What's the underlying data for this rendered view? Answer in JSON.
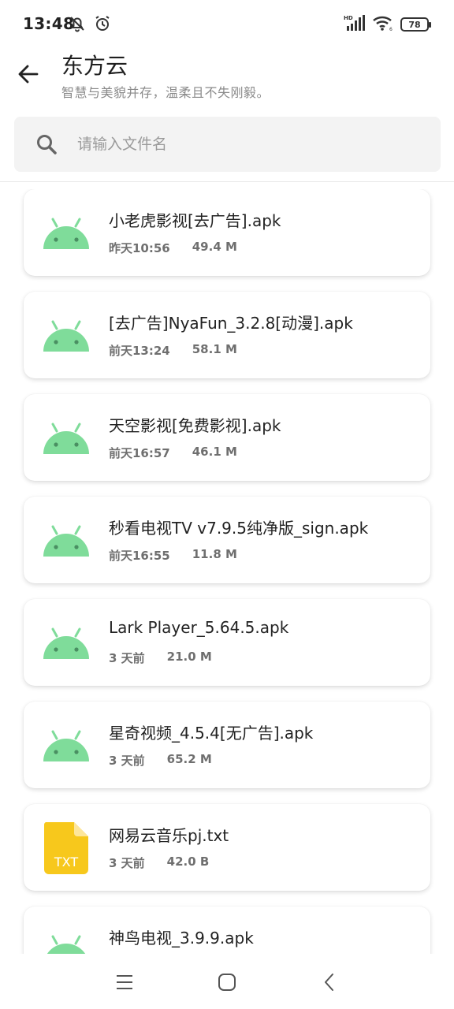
{
  "status_bar": {
    "time": "13:48",
    "battery": "78",
    "icons": [
      "bell-off-icon",
      "alarm-icon",
      "hd-signal-icon",
      "wifi-icon",
      "battery-icon"
    ]
  },
  "header": {
    "title": "东方云",
    "subtitle": "智慧与美貌并存，温柔且不失刚毅。"
  },
  "search": {
    "placeholder": "请输入文件名"
  },
  "files": [
    {
      "name": "小老虎影视[去广告].apk",
      "time": "昨天10:56",
      "size": "49.4 M",
      "type": "apk",
      "icon": "android-icon"
    },
    {
      "name": "[去广告]NyaFun_3.2.8[动漫].apk",
      "time": "前天13:24",
      "size": "58.1 M",
      "type": "apk",
      "icon": "android-icon"
    },
    {
      "name": "天空影视[免费影视].apk",
      "time": "前天16:57",
      "size": "46.1 M",
      "type": "apk",
      "icon": "android-icon"
    },
    {
      "name": "秒看电视TV v7.9.5纯净版_sign.apk",
      "time": "前天16:55",
      "size": "11.8 M",
      "type": "apk",
      "icon": "android-icon"
    },
    {
      "name": "Lark Player_5.64.5.apk",
      "time": "3 天前",
      "size": "21.0 M",
      "type": "apk",
      "icon": "android-icon"
    },
    {
      "name": "星奇视频_4.5.4[无广告].apk",
      "time": "3 天前",
      "size": "65.2 M",
      "type": "apk",
      "icon": "android-icon"
    },
    {
      "name": "网易云音乐pj.txt",
      "time": "3 天前",
      "size": "42.0 B",
      "type": "txt",
      "icon": "txt-file-icon",
      "icon_label": "TXT"
    },
    {
      "name": "神鸟电视_3.9.9.apk",
      "time": "",
      "size": "",
      "type": "apk",
      "icon": "android-icon"
    }
  ],
  "colors": {
    "android_green": "#7fdc9a",
    "txt_yellow": "#f7c81c",
    "search_bg": "#f3f3f3"
  },
  "navbar": {
    "icons": [
      "menu-icon",
      "home-icon",
      "back-nav-icon"
    ]
  }
}
